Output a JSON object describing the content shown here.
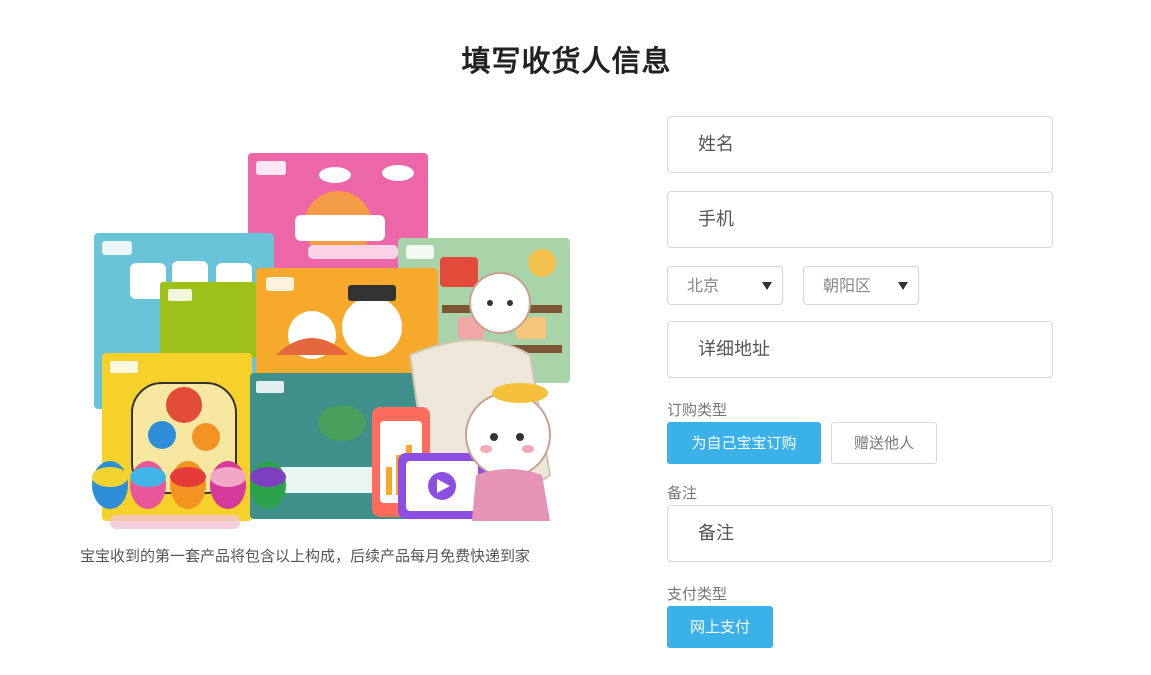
{
  "page": {
    "title": "填写收货人信息"
  },
  "product": {
    "caption": "宝宝收到的第一套产品将包含以上构成，后续产品每月免费快递到家"
  },
  "form": {
    "name_placeholder": "姓名",
    "phone_placeholder": "手机",
    "city_value": "北京",
    "district_value": "朝阳区",
    "address_placeholder": "详细地址",
    "order_type_label": "订购类型",
    "order_options": [
      "为自己宝宝订购",
      "赠送他人"
    ],
    "order_selected": "为自己宝宝订购",
    "remark_label": "备注",
    "remark_placeholder": "备注",
    "payment_type_label": "支付类型",
    "payment_option": "网上支付"
  },
  "colors": {
    "accent": "#3ab1e8",
    "border": "#d7d7d7"
  }
}
